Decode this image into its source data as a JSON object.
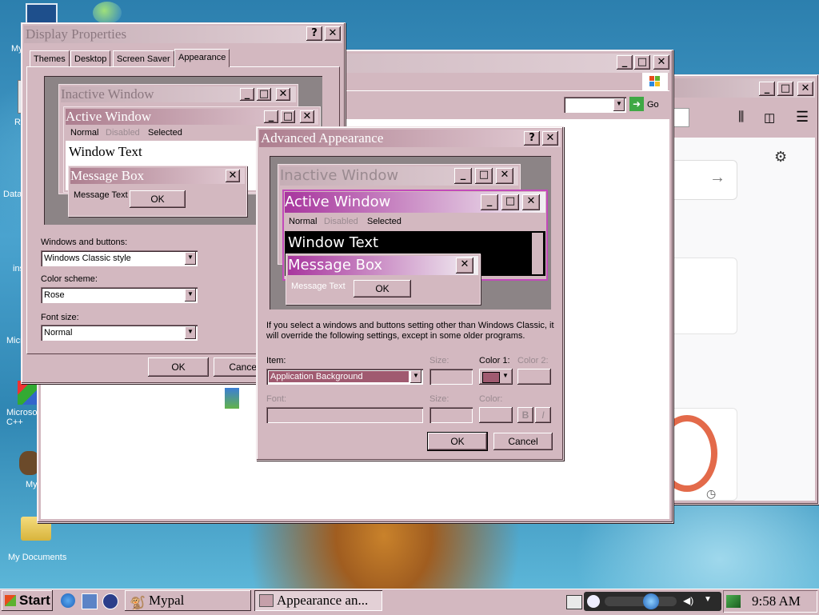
{
  "desktop": {
    "icons": [
      "My",
      "Re",
      "Data",
      "ins",
      "Micro",
      "Microsoft C++",
      "My",
      "My Documents"
    ]
  },
  "browser": {
    "go_label": "Go"
  },
  "display_properties": {
    "title": "Display Properties",
    "help": "?",
    "close": "✕",
    "tabs": [
      "Themes",
      "Desktop",
      "Screen Saver",
      "Appearance"
    ],
    "preview": {
      "inactive_title": "Inactive Window",
      "active_title": "Active Window",
      "menu": [
        "Normal",
        "Disabled",
        "Selected"
      ],
      "window_text": "Window Text",
      "msgbox_title": "Message Box",
      "msgbox_text": "Message Text",
      "msgbox_ok": "OK"
    },
    "windows_buttons_label": "Windows and buttons:",
    "windows_buttons_value": "Windows Classic style",
    "color_scheme_label": "Color scheme:",
    "color_scheme_value": "Rose",
    "font_size_label": "Font size:",
    "font_size_value": "Normal",
    "ok": "OK",
    "cancel": "Cancel"
  },
  "advanced": {
    "title": "Advanced Appearance",
    "help": "?",
    "close": "✕",
    "preview": {
      "inactive_title": "Inactive Window",
      "active_title": "Active Window",
      "menu": [
        "Normal",
        "Disabled",
        "Selected"
      ],
      "window_text": "Window Text",
      "msgbox_title": "Message Box",
      "msgbox_text": "Message Text",
      "msgbox_ok": "OK"
    },
    "info": "If you select a windows and buttons setting other than Windows Classic, it will override the following settings, except in some older programs.",
    "item_label": "Item:",
    "item_value": "Application Background",
    "size_label": "Size:",
    "color1_label": "Color 1:",
    "color2_label": "Color 2:",
    "font_label": "Font:",
    "font_size_label": "Size:",
    "font_color_label": "Color:",
    "bold": "B",
    "italic": "I",
    "ok": "OK",
    "cancel": "Cancel"
  },
  "taskbar": {
    "start": "Start",
    "tasks": [
      "Mypal",
      "Appearance an..."
    ],
    "clock": "9:58 AM"
  },
  "colors": {
    "face": "#d3b8c0",
    "active_title": "#ad7e8f",
    "preview_active": "#a8369e"
  }
}
